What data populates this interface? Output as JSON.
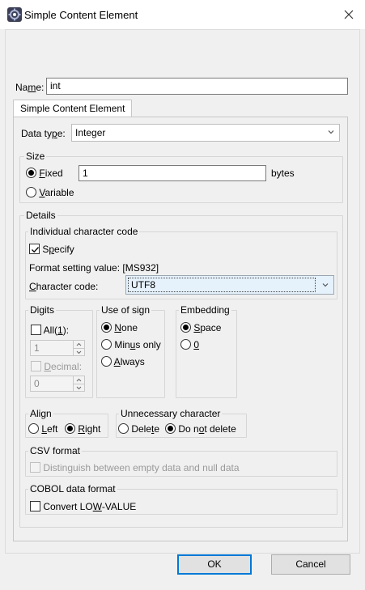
{
  "window": {
    "title": "Simple Content Element",
    "app_icon": "gear-app-icon",
    "close_icon": "close-icon"
  },
  "name_field": {
    "label": "Name:",
    "value": "int"
  },
  "tab": {
    "label": "Simple Content Element"
  },
  "data_type": {
    "label": "Data type:",
    "value": "Integer"
  },
  "size": {
    "legend": "Size",
    "fixed_label": "Fixed",
    "fixed_value": "1",
    "unit": "bytes",
    "variable_label": "Variable",
    "selected": "Fixed"
  },
  "details": {
    "legend": "Details",
    "char_code_group": {
      "legend": "Individual character code",
      "specify_label": "Specify",
      "specify_checked": true,
      "format_setting": "Format setting value: [MS932]",
      "char_code_label": "Character code:",
      "char_code_value": "UTF8"
    },
    "digits": {
      "legend": "Digits",
      "all_label": "All(1):",
      "all_value": "1",
      "decimal_label": "Decimal:",
      "decimal_value": "0"
    },
    "use_of_sign": {
      "legend": "Use of sign",
      "options": [
        "None",
        "Minus only",
        "Always"
      ],
      "selected": "None"
    },
    "embedding": {
      "legend": "Embedding",
      "options": [
        "Space",
        "0"
      ],
      "selected": "Space"
    },
    "align": {
      "legend": "Align",
      "options": [
        "Left",
        "Right"
      ],
      "selected": "Right"
    },
    "unnecessary": {
      "legend": "Unnecessary character",
      "options": [
        "Delete",
        "Do not delete"
      ],
      "selected": "Do not delete"
    },
    "csv": {
      "legend": "CSV format",
      "distinguish_label": "Distinguish between empty data and null data"
    },
    "cobol": {
      "legend": "COBOL data format",
      "convert_label": "Convert LOW-VALUE"
    }
  },
  "buttons": {
    "ok": "OK",
    "cancel": "Cancel"
  },
  "colors": {
    "accent": "#0078d7",
    "window_bg": "#f0f0f0",
    "highlight": "#e5f1fb"
  }
}
